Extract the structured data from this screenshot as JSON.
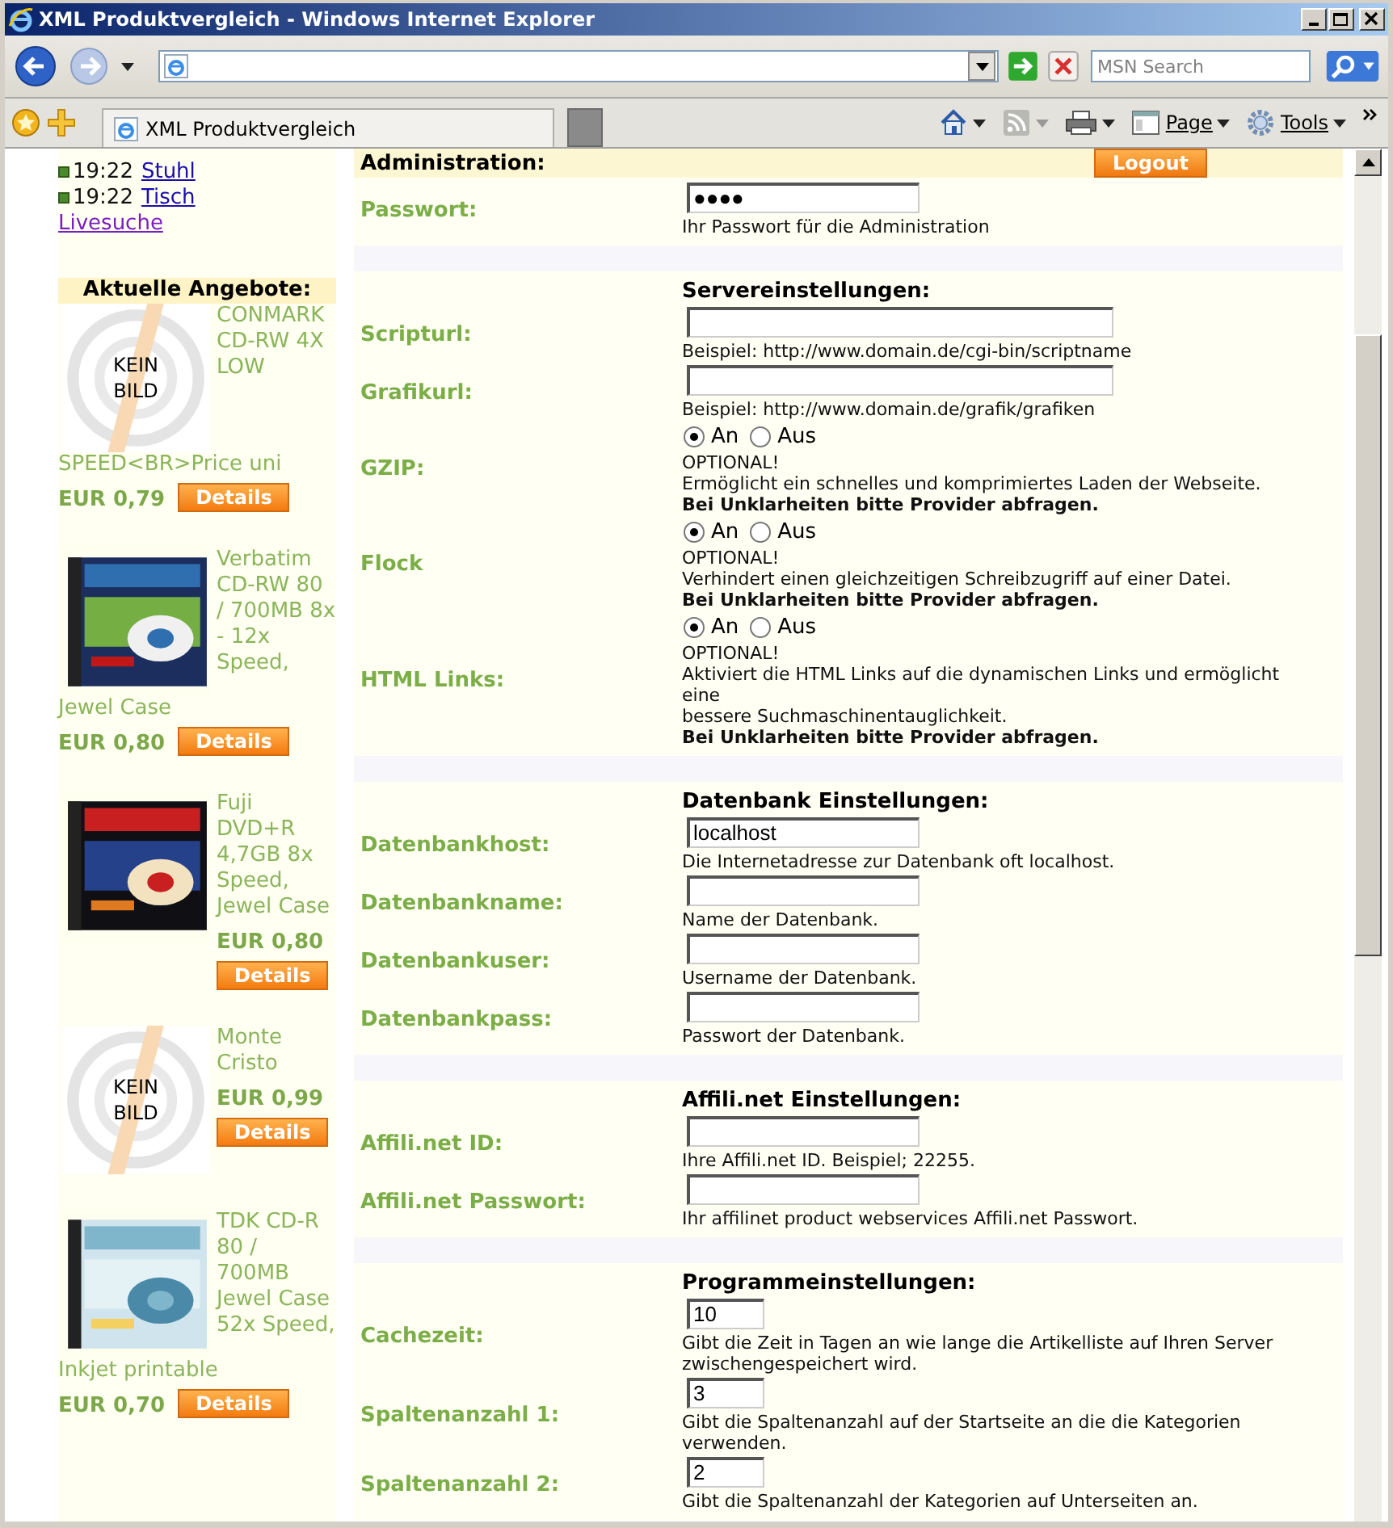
{
  "window": {
    "title": "XML Produktvergleich - Windows Internet Explorer"
  },
  "search": {
    "placeholder": "MSN Search"
  },
  "tabs": [
    {
      "label": "XML Produktvergleich",
      "selected": true
    }
  ],
  "command_bar": {
    "page": "Page",
    "tools": "Tools"
  },
  "sidebar": {
    "news": [
      {
        "time": "19:22",
        "title": "Stuhl"
      },
      {
        "time": "19:22",
        "title": "Tisch"
      }
    ],
    "search_link": "Livesuche",
    "offers_title": "Aktuelle Angebote:",
    "offers": [
      {
        "image_text": "KEIN BILD",
        "title": "CONMARK CD-RW 4X LOW",
        "title_continued": "SPEED<BR>Price uni",
        "price": "EUR 0,79",
        "button": "Details"
      },
      {
        "title": "Verbatim CD-RW 80 / 700MB 8x - 12x Speed,",
        "title_continued": "Jewel Case",
        "price": "EUR 0,80",
        "button": "Details"
      },
      {
        "title": "Fuji DVD+R 4,7GB 8x Speed, Jewel Case",
        "price": "EUR 0,80",
        "button": "Details"
      },
      {
        "image_text": "KEIN BILD",
        "title": "Monte Cristo",
        "price": "EUR 0,99",
        "button": "Details"
      },
      {
        "title": "TDK CD-R 80 / 700MB Jewel Case 52x Speed,",
        "title_continued": "Inkjet printable",
        "price": "EUR 0,70",
        "button": "Details"
      }
    ]
  },
  "form": {
    "header": {
      "title": "Administration:",
      "logout": "Logout"
    },
    "sections": [
      {
        "rows": [
          {
            "label": "Passwort:",
            "kind": "text",
            "value": "●●●●",
            "help": [
              "Ihr Passwort für die Administration"
            ]
          }
        ]
      },
      {
        "heading": "Servereinstellungen:",
        "rows": [
          {
            "label": "Scripturl:",
            "kind": "url",
            "help": [
              "Beispiel: http://www.domain.de/cgi-bin/scriptname"
            ]
          },
          {
            "label": "Grafikurl:",
            "kind": "url",
            "help": [
              "Beispiel: http://www.domain.de/grafik/grafiken"
            ]
          },
          {
            "label": "GZIP:",
            "kind": "radio",
            "options": [
              {
                "label": "An",
                "selected": true
              },
              {
                "label": "Aus",
                "selected": false
              }
            ],
            "help": [
              "OPTIONAL!",
              "Ermöglicht ein schnelles und komprimiertes Laden der Webseite."
            ],
            "warning": "Bei Unklarheiten bitte Provider abfragen."
          },
          {
            "label": "Flock",
            "kind": "radio",
            "options": [
              {
                "label": "An",
                "selected": true
              },
              {
                "label": "Aus",
                "selected": false
              }
            ],
            "help": [
              "OPTIONAL!",
              "Verhindert einen gleichzeitigen Schreibzugriff auf einer Datei."
            ],
            "warning": "Bei Unklarheiten bitte Provider abfragen."
          },
          {
            "label": "HTML Links:",
            "kind": "radio",
            "options": [
              {
                "label": "An",
                "selected": true
              },
              {
                "label": "Aus",
                "selected": false
              }
            ],
            "help": [
              "OPTIONAL!",
              "Aktiviert die HTML Links auf die dynamischen Links und ermöglicht eine",
              "bessere Suchmaschinentauglichkeit."
            ],
            "warning": "Bei Unklarheiten bitte Provider abfragen."
          }
        ]
      },
      {
        "heading": "Datenbank Einstellungen:",
        "rows": [
          {
            "label": "Datenbankhost:",
            "kind": "text",
            "value": "localhost",
            "help": [
              "Die Internetadresse zur Datenbank oft localhost."
            ]
          },
          {
            "label": "Datenbankname:",
            "kind": "text",
            "help": [
              "Name der Datenbank."
            ]
          },
          {
            "label": "Datenbankuser:",
            "kind": "text",
            "help": [
              "Username der Datenbank."
            ]
          },
          {
            "label": "Datenbankpass:",
            "kind": "text",
            "help": [
              "Passwort der Datenbank."
            ]
          }
        ]
      },
      {
        "heading": "Affili.net Einstellungen:",
        "rows": [
          {
            "label": "Affili.net ID:",
            "kind": "text",
            "help": [
              "Ihre Affili.net ID. Beispiel; 22255."
            ]
          },
          {
            "label": "Affili.net Passwort:",
            "kind": "text",
            "help": [
              "Ihr affilinet product webservices Affili.net Passwort."
            ]
          }
        ]
      },
      {
        "heading": "Programmeinstellungen:",
        "rows": [
          {
            "label": "Cachezeit:",
            "kind": "number",
            "value": "10",
            "help": [
              "Gibt die Zeit in Tagen an wie lange die Artikelliste auf Ihren Server",
              "zwischengespeichert wird."
            ]
          },
          {
            "label": "Spaltenanzahl 1:",
            "kind": "number",
            "value": "3",
            "help": [
              "Gibt die Spaltenanzahl auf der Startseite an die die Kategorien verwenden."
            ]
          },
          {
            "label": "Spaltenanzahl 2:",
            "kind": "number",
            "value": "2",
            "help": [
              "Gibt die Spaltenanzahl der Kategorien auf Unterseiten an."
            ]
          }
        ]
      }
    ]
  }
}
